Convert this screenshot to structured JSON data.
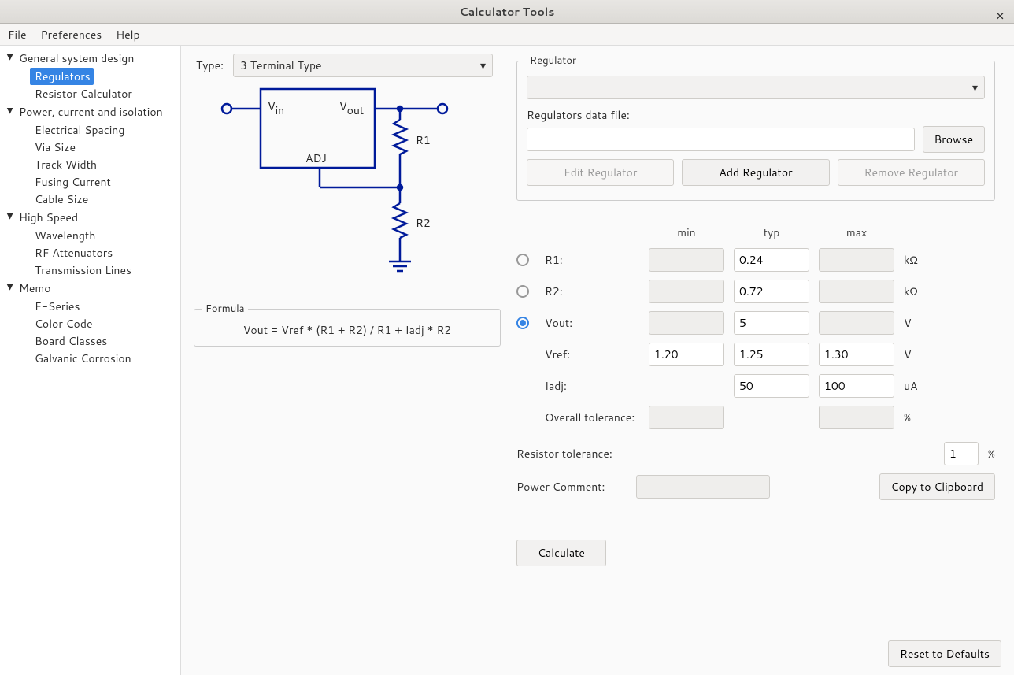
{
  "titlebar": {
    "title": "Calculator Tools"
  },
  "menubar": {
    "file": "File",
    "prefs": "Preferences",
    "help": "Help"
  },
  "sidebar": {
    "groups": [
      {
        "label": "General system design",
        "items": [
          "Regulators",
          "Resistor Calculator"
        ],
        "selected": 0
      },
      {
        "label": "Power, current and isolation",
        "items": [
          "Electrical Spacing",
          "Via Size",
          "Track Width",
          "Fusing Current",
          "Cable Size"
        ]
      },
      {
        "label": "High Speed",
        "items": [
          "Wavelength",
          "RF Attenuators",
          "Transmission Lines"
        ]
      },
      {
        "label": "Memo",
        "items": [
          "E-Series",
          "Color Code",
          "Board Classes",
          "Galvanic Corrosion"
        ]
      }
    ]
  },
  "type": {
    "label": "Type:",
    "value": "3 Terminal Type"
  },
  "diagram": {
    "vin": "V",
    "vin_sub": "in",
    "vout": "V",
    "vout_sub": "out",
    "adj": "ADJ",
    "r1": "R1",
    "r2": "R2"
  },
  "formula": {
    "legend": "Formula",
    "text": "Vout = Vref * (R1 + R2) / R1 + Iadj * R2"
  },
  "regbox": {
    "legend": "Regulator",
    "datafile_label": "Regulators data file:",
    "browse": "Browse",
    "edit": "Edit Regulator",
    "add": "Add Regulator",
    "remove": "Remove Regulator"
  },
  "params": {
    "min": "min",
    "typ": "typ",
    "max": "max",
    "r1": {
      "label": "R1:",
      "typ": "0.24",
      "unit": "kΩ"
    },
    "r2": {
      "label": "R2:",
      "typ": "0.72",
      "unit": "kΩ"
    },
    "vout": {
      "label": "Vout:",
      "typ": "5",
      "unit": "V"
    },
    "vref": {
      "label": "Vref:",
      "min": "1.20",
      "typ": "1.25",
      "max": "1.30",
      "unit": "V"
    },
    "iadj": {
      "label": "Iadj:",
      "typ": "50",
      "max": "100",
      "unit": "uA"
    },
    "overall": {
      "label": "Overall tolerance:",
      "unit": "%"
    }
  },
  "rtol": {
    "label": "Resistor tolerance:",
    "value": "1",
    "unit": "%"
  },
  "pcomment": {
    "label": "Power Comment:"
  },
  "copy": "Copy to Clipboard",
  "calc": "Calculate",
  "reset": "Reset to Defaults"
}
